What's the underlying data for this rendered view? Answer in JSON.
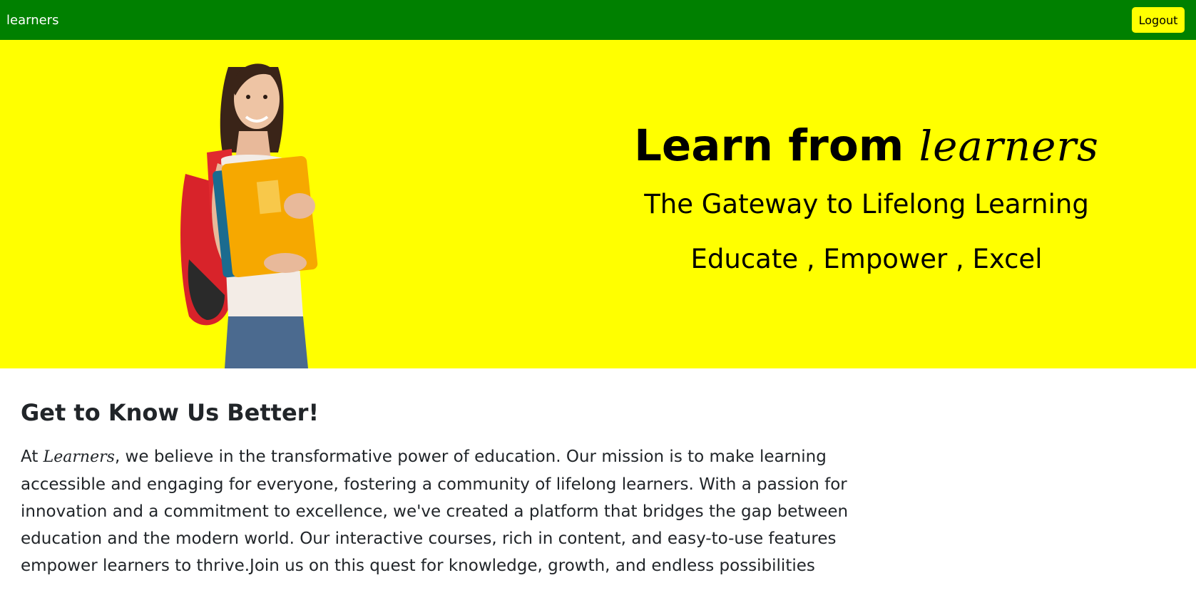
{
  "navbar": {
    "brand": "learners",
    "logout_label": "Logout",
    "background_color": "#008000",
    "button_color": "#ffff00"
  },
  "hero": {
    "background_color": "#ffff00",
    "title_prefix": "Learn from",
    "title_script": "learners",
    "subtitle": "The Gateway to Lifelong Learning",
    "motto": "Educate , Empower , Excel"
  },
  "about": {
    "heading": "Get to Know Us Better!",
    "intro_prefix": "At",
    "brand_script": "Learners",
    "body": ", we believe in the transformative power of education. Our mission is to make learning accessible and engaging for everyone, fostering a community of lifelong learners. With a passion for innovation and a commitment to excellence, we've created a platform that bridges the gap between education and the modern world. Our interactive courses, rich in content, and easy-to-use features empower learners to thrive.Join us on this quest for knowledge, growth, and endless possibilities"
  }
}
